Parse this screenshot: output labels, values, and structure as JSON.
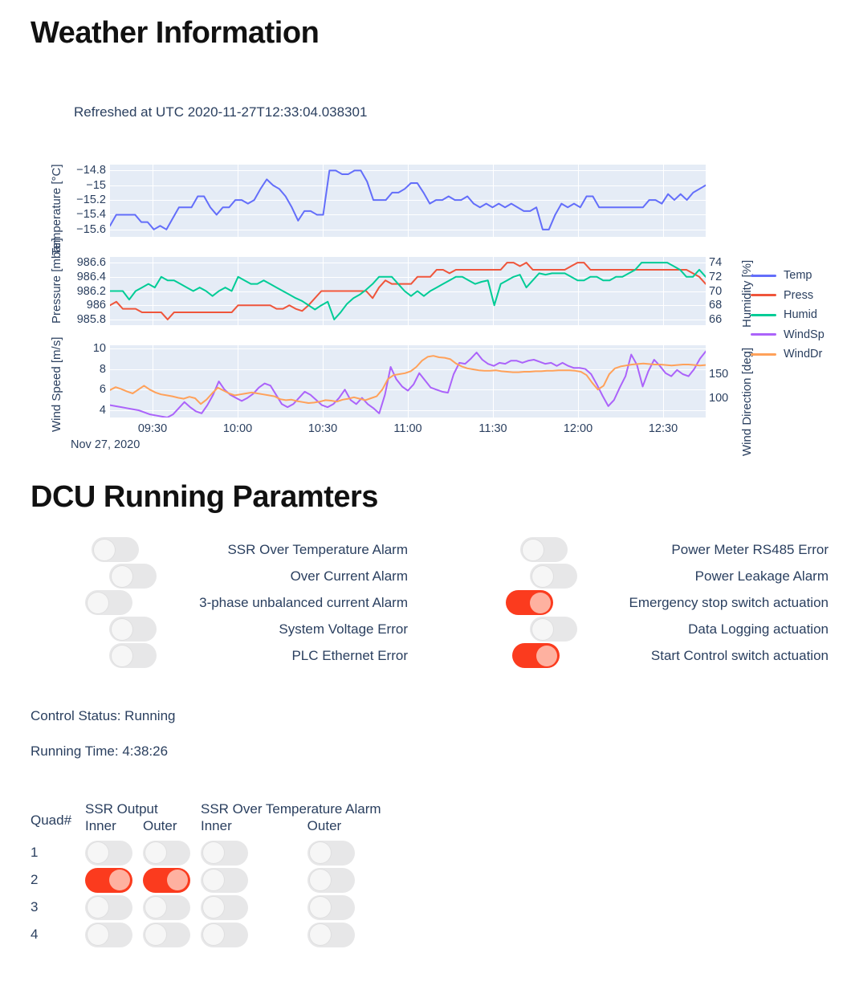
{
  "weather": {
    "title": "Weather Information",
    "subtitle": "Refreshed at UTC 2020-11-27T12:33:04.038301"
  },
  "dcu": {
    "title": "DCU Running Paramters",
    "control_status": "Control Status: Running",
    "running_time": "Running Time: 4:38:26",
    "left_switches": [
      {
        "label": "SSR Over Temperature Alarm",
        "state": "off"
      },
      {
        "label": "Over Current Alarm",
        "state": "off"
      },
      {
        "label": "3-phase unbalanced current Alarm",
        "state": "off"
      },
      {
        "label": "System Voltage Error",
        "state": "off"
      },
      {
        "label": "PLC Ethernet Error",
        "state": "off"
      }
    ],
    "right_switches": [
      {
        "label": "Power Meter RS485 Error",
        "state": "off"
      },
      {
        "label": "Power Leakage Alarm",
        "state": "off"
      },
      {
        "label": "Emergency stop switch actuation",
        "state": "on"
      },
      {
        "label": "Data Logging actuation",
        "state": "off"
      },
      {
        "label": "Start Control switch actuation",
        "state": "on"
      }
    ]
  },
  "quad_table": {
    "corner_header": "Quad#",
    "group_headers": [
      "SSR Output",
      "SSR Over Temperature Alarm"
    ],
    "sub_headers": [
      "Inner",
      "Outer",
      "Inner",
      "Outer"
    ],
    "rows": [
      {
        "quad": "1",
        "ssr_output_inner": "off",
        "ssr_output_outer": "off",
        "ssr_overtemp_inner": "off",
        "ssr_overtemp_outer": "off"
      },
      {
        "quad": "2",
        "ssr_output_inner": "on",
        "ssr_output_outer": "on",
        "ssr_overtemp_inner": "off",
        "ssr_overtemp_outer": "off"
      },
      {
        "quad": "3",
        "ssr_output_inner": "off",
        "ssr_output_outer": "off",
        "ssr_overtemp_inner": "off",
        "ssr_overtemp_outer": "off"
      },
      {
        "quad": "4",
        "ssr_output_inner": "off",
        "ssr_output_outer": "off",
        "ssr_overtemp_inner": "off",
        "ssr_overtemp_outer": "off"
      }
    ]
  },
  "colors": {
    "temp": "#636EFA",
    "press": "#EF553B",
    "humid": "#00CC96",
    "windsp": "#AB63FA",
    "winddr": "#FFA15A",
    "plot_bg": "#E5ECF6",
    "grid": "#FFFFFF",
    "toggle_on": "#FB3B1E",
    "toggle_on_knob": "#FEB1A0",
    "toggle_off": "#E7E7E8",
    "text": "#2A3F5F"
  },
  "chart_data": {
    "type": "line",
    "title": "",
    "subtitle": "Refreshed at UTC 2020-11-27T12:33:04.038301",
    "xlabel": "Nov 27, 2020",
    "x_tick_labels": [
      "09:30",
      "10:00",
      "10:30",
      "11:00",
      "11:30",
      "12:00",
      "12:30"
    ],
    "x_range": [
      "09:25",
      "12:35"
    ],
    "grid": true,
    "legend_position": "right",
    "legend": [
      "Temp",
      "Press",
      "Humid",
      "WindSp",
      "WindDr"
    ],
    "subplots": [
      {
        "index": 1,
        "y_left_label": "Temperature [°C]",
        "y_left_ticks": [
          -14.8,
          -15,
          -15.2,
          -15.4,
          -15.6
        ],
        "y_left_range": [
          -15.7,
          -14.72
        ],
        "series": [
          {
            "name": "Temp",
            "axis": "left",
            "color": "#636EFA",
            "units": "°C",
            "values": [
              -15.55,
              -15.4,
              -15.4,
              -15.4,
              -15.4,
              -15.5,
              -15.5,
              -15.6,
              -15.55,
              -15.6,
              -15.45,
              -15.3,
              -15.3,
              -15.3,
              -15.15,
              -15.15,
              -15.3,
              -15.4,
              -15.3,
              -15.3,
              -15.2,
              -15.2,
              -15.25,
              -15.2,
              -15.05,
              -14.92,
              -15.0,
              -15.05,
              -15.15,
              -15.3,
              -15.48,
              -15.35,
              -15.35,
              -15.4,
              -15.4,
              -14.8,
              -14.8,
              -14.85,
              -14.85,
              -14.8,
              -14.8,
              -14.95,
              -15.2,
              -15.2,
              -15.2,
              -15.1,
              -15.1,
              -15.05,
              -14.97,
              -14.97,
              -15.1,
              -15.25,
              -15.2,
              -15.2,
              -15.15,
              -15.2,
              -15.2,
              -15.15,
              -15.25,
              -15.3,
              -15.25,
              -15.3,
              -15.25,
              -15.3,
              -15.25,
              -15.3,
              -15.35,
              -15.35,
              -15.3,
              -15.6,
              -15.6,
              -15.4,
              -15.25,
              -15.3,
              -15.25,
              -15.3,
              -15.15,
              -15.15,
              -15.3,
              -15.3,
              -15.3,
              -15.3,
              -15.3,
              -15.3,
              -15.3,
              -15.3,
              -15.2,
              -15.2,
              -15.25,
              -15.12,
              -15.2,
              -15.12,
              -15.2,
              -15.1,
              -15.05,
              -15.0
            ]
          }
        ]
      },
      {
        "index": 2,
        "y_left_label": "Pressure [mbar]",
        "y_left_ticks": [
          986.6,
          986.4,
          986.2,
          986,
          985.8
        ],
        "y_left_range": [
          985.72,
          986.68
        ],
        "y_right_label": "Humidity [%]",
        "y_right_ticks": [
          74,
          72,
          70,
          68,
          66
        ],
        "y_right_range": [
          65.2,
          74.8
        ],
        "series": [
          {
            "name": "Press",
            "axis": "left",
            "color": "#EF553B",
            "units": "mbar",
            "values": [
              986.0,
              986.05,
              985.95,
              985.95,
              985.95,
              985.9,
              985.9,
              985.9,
              985.9,
              985.8,
              985.9,
              985.9,
              985.9,
              985.9,
              985.9,
              985.9,
              985.9,
              985.9,
              985.9,
              985.9,
              986.0,
              986.0,
              986.0,
              986.0,
              986.0,
              986.0,
              985.95,
              985.95,
              986.0,
              985.95,
              985.92,
              986.0,
              986.1,
              986.2,
              986.2,
              986.2,
              986.2,
              986.2,
              986.2,
              986.2,
              986.2,
              986.1,
              986.25,
              986.35,
              986.3,
              986.3,
              986.3,
              986.3,
              986.4,
              986.4,
              986.4,
              986.5,
              986.5,
              986.45,
              986.5,
              986.5,
              986.5,
              986.5,
              986.5,
              986.5,
              986.5,
              986.5,
              986.6,
              986.6,
              986.55,
              986.6,
              986.5,
              986.5,
              986.5,
              986.5,
              986.5,
              986.5,
              986.55,
              986.6,
              986.6,
              986.5,
              986.5,
              986.5,
              986.5,
              986.5,
              986.5,
              986.5,
              986.5,
              986.5,
              986.5,
              986.5,
              986.5,
              986.5,
              986.5,
              986.5,
              986.5,
              986.45,
              986.4,
              986.3
            ]
          },
          {
            "name": "Humid",
            "axis": "right",
            "color": "#00CC96",
            "units": "%",
            "values": [
              70.0,
              70.0,
              70.0,
              68.8,
              70.0,
              70.5,
              71.0,
              70.5,
              72.0,
              71.5,
              71.5,
              71.0,
              70.5,
              70.0,
              70.5,
              70.0,
              69.3,
              70.0,
              70.5,
              70.0,
              72.0,
              71.5,
              71.0,
              71.0,
              71.5,
              71.0,
              70.5,
              70.0,
              69.5,
              69.0,
              68.6,
              68.0,
              67.4,
              68.0,
              68.5,
              66.0,
              67.0,
              68.2,
              69.0,
              69.5,
              70.2,
              71.0,
              72.0,
              72.0,
              72.0,
              71.0,
              70.0,
              69.3,
              70.0,
              69.3,
              70.0,
              70.5,
              71.0,
              71.5,
              72.0,
              72.0,
              71.5,
              71.0,
              71.3,
              71.5,
              68.0,
              71.0,
              71.5,
              72.0,
              72.3,
              70.5,
              71.5,
              72.5,
              72.3,
              72.5,
              72.5,
              72.5,
              72.0,
              71.5,
              71.5,
              72.0,
              72.0,
              71.5,
              71.5,
              72.0,
              72.0,
              72.5,
              73.0,
              74.0,
              74.0,
              74.0,
              74.0,
              74.0,
              73.5,
              73.0,
              72.0,
              72.0,
              73.0,
              72.0
            ]
          }
        ]
      },
      {
        "index": 3,
        "y_left_label": "Wind Speed [m/s]",
        "y_left_ticks": [
          10,
          8,
          6,
          4
        ],
        "y_left_range": [
          3.3,
          10.3
        ],
        "y_right_label": "Wind Direction [deg]",
        "y_right_ticks": [
          150,
          100
        ],
        "y_right_range": [
          60,
          210
        ],
        "series": [
          {
            "name": "WindSp",
            "axis": "left",
            "color": "#AB63FA",
            "units": "m/s",
            "values": [
              4.5,
              4.4,
              4.3,
              4.2,
              4.1,
              4.0,
              3.8,
              3.6,
              3.5,
              3.4,
              3.3,
              3.6,
              4.2,
              4.8,
              4.3,
              3.9,
              3.7,
              4.5,
              5.5,
              6.8,
              6.0,
              5.5,
              5.2,
              4.9,
              5.2,
              5.6,
              6.2,
              6.6,
              6.4,
              5.5,
              4.6,
              4.3,
              4.6,
              5.2,
              5.8,
              5.5,
              5.0,
              4.5,
              4.3,
              4.6,
              5.2,
              6.0,
              5.0,
              4.6,
              5.2,
              4.6,
              4.2,
              3.7,
              5.5,
              8.2,
              7.0,
              6.3,
              5.9,
              6.5,
              7.6,
              6.9,
              6.2,
              6.0,
              5.8,
              5.7,
              7.5,
              8.6,
              8.5,
              9.0,
              9.6,
              8.9,
              8.5,
              8.3,
              8.6,
              8.5,
              8.8,
              8.8,
              8.6,
              8.8,
              8.9,
              8.7,
              8.5,
              8.6,
              8.3,
              8.6,
              8.3,
              8.1,
              8.1,
              8.0,
              7.5,
              6.5,
              5.4,
              4.4,
              5.0,
              6.2,
              7.3,
              9.4,
              8.4,
              6.3,
              7.8,
              8.9,
              8.3,
              7.6,
              7.3,
              7.9,
              7.5,
              7.3,
              8.0,
              9.0,
              9.7
            ]
          },
          {
            "name": "WindDr",
            "axis": "right",
            "color": "#FFA15A",
            "units": "deg",
            "values": [
              117,
              123,
              119,
              114,
              110,
              118,
              126,
              118,
              112,
              108,
              106,
              104,
              101,
              99,
              103,
              100,
              88,
              97,
              110,
              122,
              116,
              110,
              106,
              108,
              110,
              112,
              110,
              108,
              106,
              104,
              98,
              96,
              97,
              94,
              92,
              90,
              91,
              93,
              96,
              95,
              93,
              97,
              99,
              102,
              99,
              96,
              100,
              104,
              118,
              140,
              148,
              150,
              152,
              156,
              165,
              178,
              186,
              188,
              185,
              184,
              181,
              172,
              166,
              162,
              160,
              158,
              157,
              157,
              158,
              156,
              155,
              154,
              154,
              155,
              155,
              156,
              156,
              157,
              157,
              158,
              158,
              158,
              157,
              155,
              148,
              132,
              118,
              126,
              150,
              162,
              166,
              168,
              170,
              171,
              172,
              171,
              170,
              170,
              169,
              168,
              169,
              170,
              170,
              169,
              168,
              169
            ]
          }
        ]
      }
    ]
  }
}
